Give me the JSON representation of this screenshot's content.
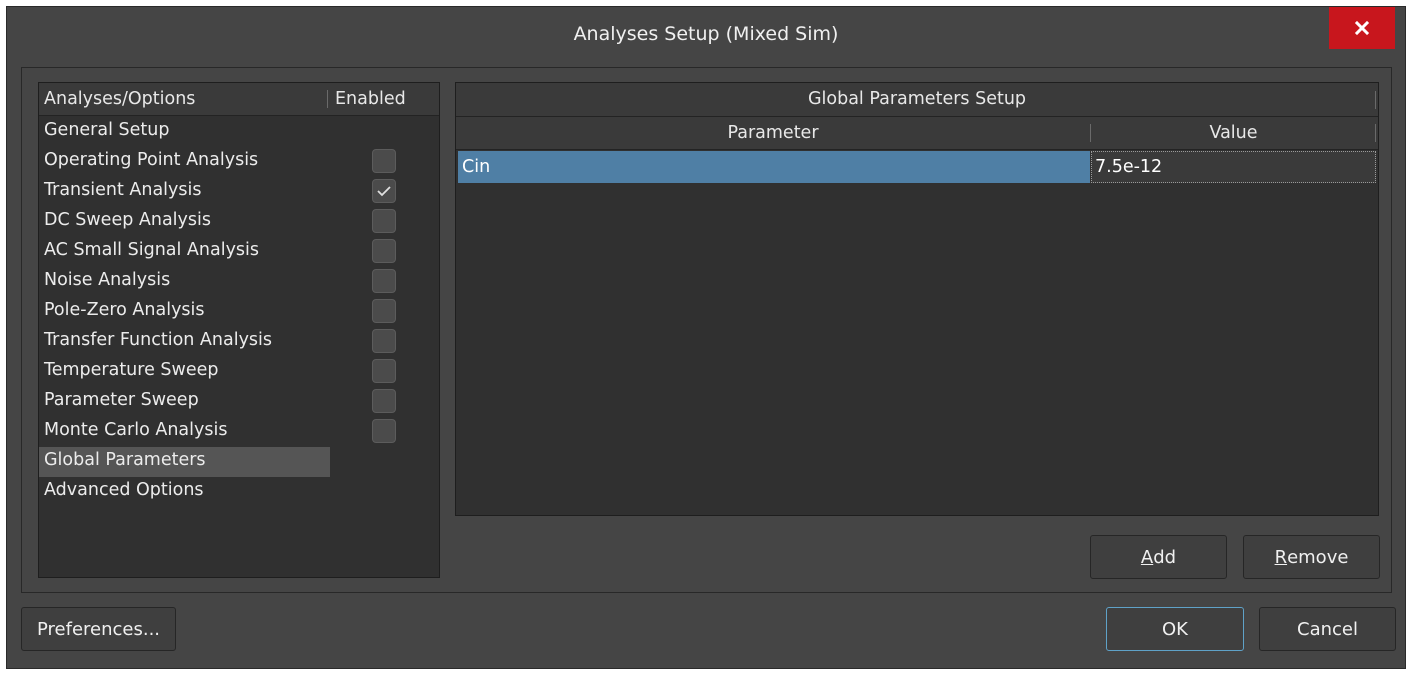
{
  "window": {
    "title": "Analyses Setup (Mixed Sim)",
    "close_icon": "close-icon"
  },
  "left_panel": {
    "col_analyses": "Analyses/Options",
    "col_enabled": "Enabled",
    "items": [
      {
        "label": "General Setup",
        "has_checkbox": false,
        "checked": false,
        "selected": false
      },
      {
        "label": "Operating Point Analysis",
        "has_checkbox": true,
        "checked": false,
        "selected": false
      },
      {
        "label": "Transient Analysis",
        "has_checkbox": true,
        "checked": true,
        "selected": false
      },
      {
        "label": "DC Sweep Analysis",
        "has_checkbox": true,
        "checked": false,
        "selected": false
      },
      {
        "label": "AC Small Signal Analysis",
        "has_checkbox": true,
        "checked": false,
        "selected": false
      },
      {
        "label": "Noise Analysis",
        "has_checkbox": true,
        "checked": false,
        "selected": false
      },
      {
        "label": "Pole-Zero Analysis",
        "has_checkbox": true,
        "checked": false,
        "selected": false
      },
      {
        "label": "Transfer Function Analysis",
        "has_checkbox": true,
        "checked": false,
        "selected": false
      },
      {
        "label": "Temperature Sweep",
        "has_checkbox": true,
        "checked": false,
        "selected": false
      },
      {
        "label": "Parameter Sweep",
        "has_checkbox": true,
        "checked": false,
        "selected": false
      },
      {
        "label": "Monte Carlo Analysis",
        "has_checkbox": true,
        "checked": false,
        "selected": false
      },
      {
        "label": "Global Parameters",
        "has_checkbox": false,
        "checked": false,
        "selected": true
      },
      {
        "label": "Advanced Options",
        "has_checkbox": false,
        "checked": false,
        "selected": false
      }
    ]
  },
  "right_panel": {
    "title": "Global Parameters Setup",
    "col_parameter": "Parameter",
    "col_value": "Value",
    "rows": [
      {
        "parameter": "Cin",
        "value": "7.5e-12"
      }
    ]
  },
  "buttons": {
    "add": {
      "accel": "A",
      "rest": "dd"
    },
    "remove": {
      "accel": "R",
      "rest": "emove"
    },
    "preferences": "Preferences...",
    "ok": "OK",
    "cancel": "Cancel"
  },
  "colors": {
    "dialog_bg": "#454545",
    "panel_bg": "#303030",
    "selection_blue": "#4f7fa5",
    "close_red": "#c8161d",
    "ok_focus_border": "#5fa2c8"
  }
}
